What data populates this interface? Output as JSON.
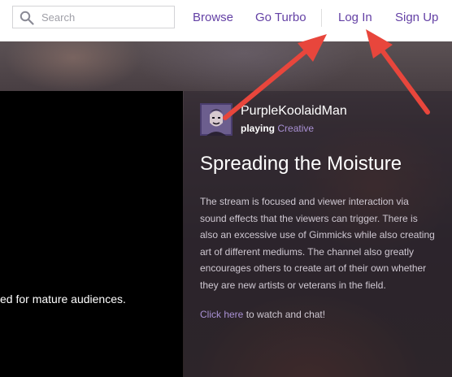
{
  "header": {
    "search": {
      "placeholder": "Search",
      "icon": "search-icon"
    },
    "nav": {
      "browse": "Browse",
      "turbo": "Go Turbo",
      "login": "Log In",
      "signup": "Sign Up"
    }
  },
  "player": {
    "notice": "ed for mature audiences."
  },
  "channel": {
    "name": "PurpleKoolaidMan",
    "playing_label": "playing",
    "game": "Creative",
    "title": "Spreading the Moisture",
    "description": "The stream is focused and viewer interaction via sound effects that the viewers can trigger. There is also an excessive use of Gimmicks while also creating art of different mediums. The channel also greatly encourages others to create art of their own whether they are new artists or veterans in the field.",
    "cta_link": "Click here",
    "cta_rest": " to watch and chat!"
  },
  "colors": {
    "brand": "#6441a5",
    "link_light": "#a991d4",
    "annotation_arrow": "#e8463c"
  }
}
